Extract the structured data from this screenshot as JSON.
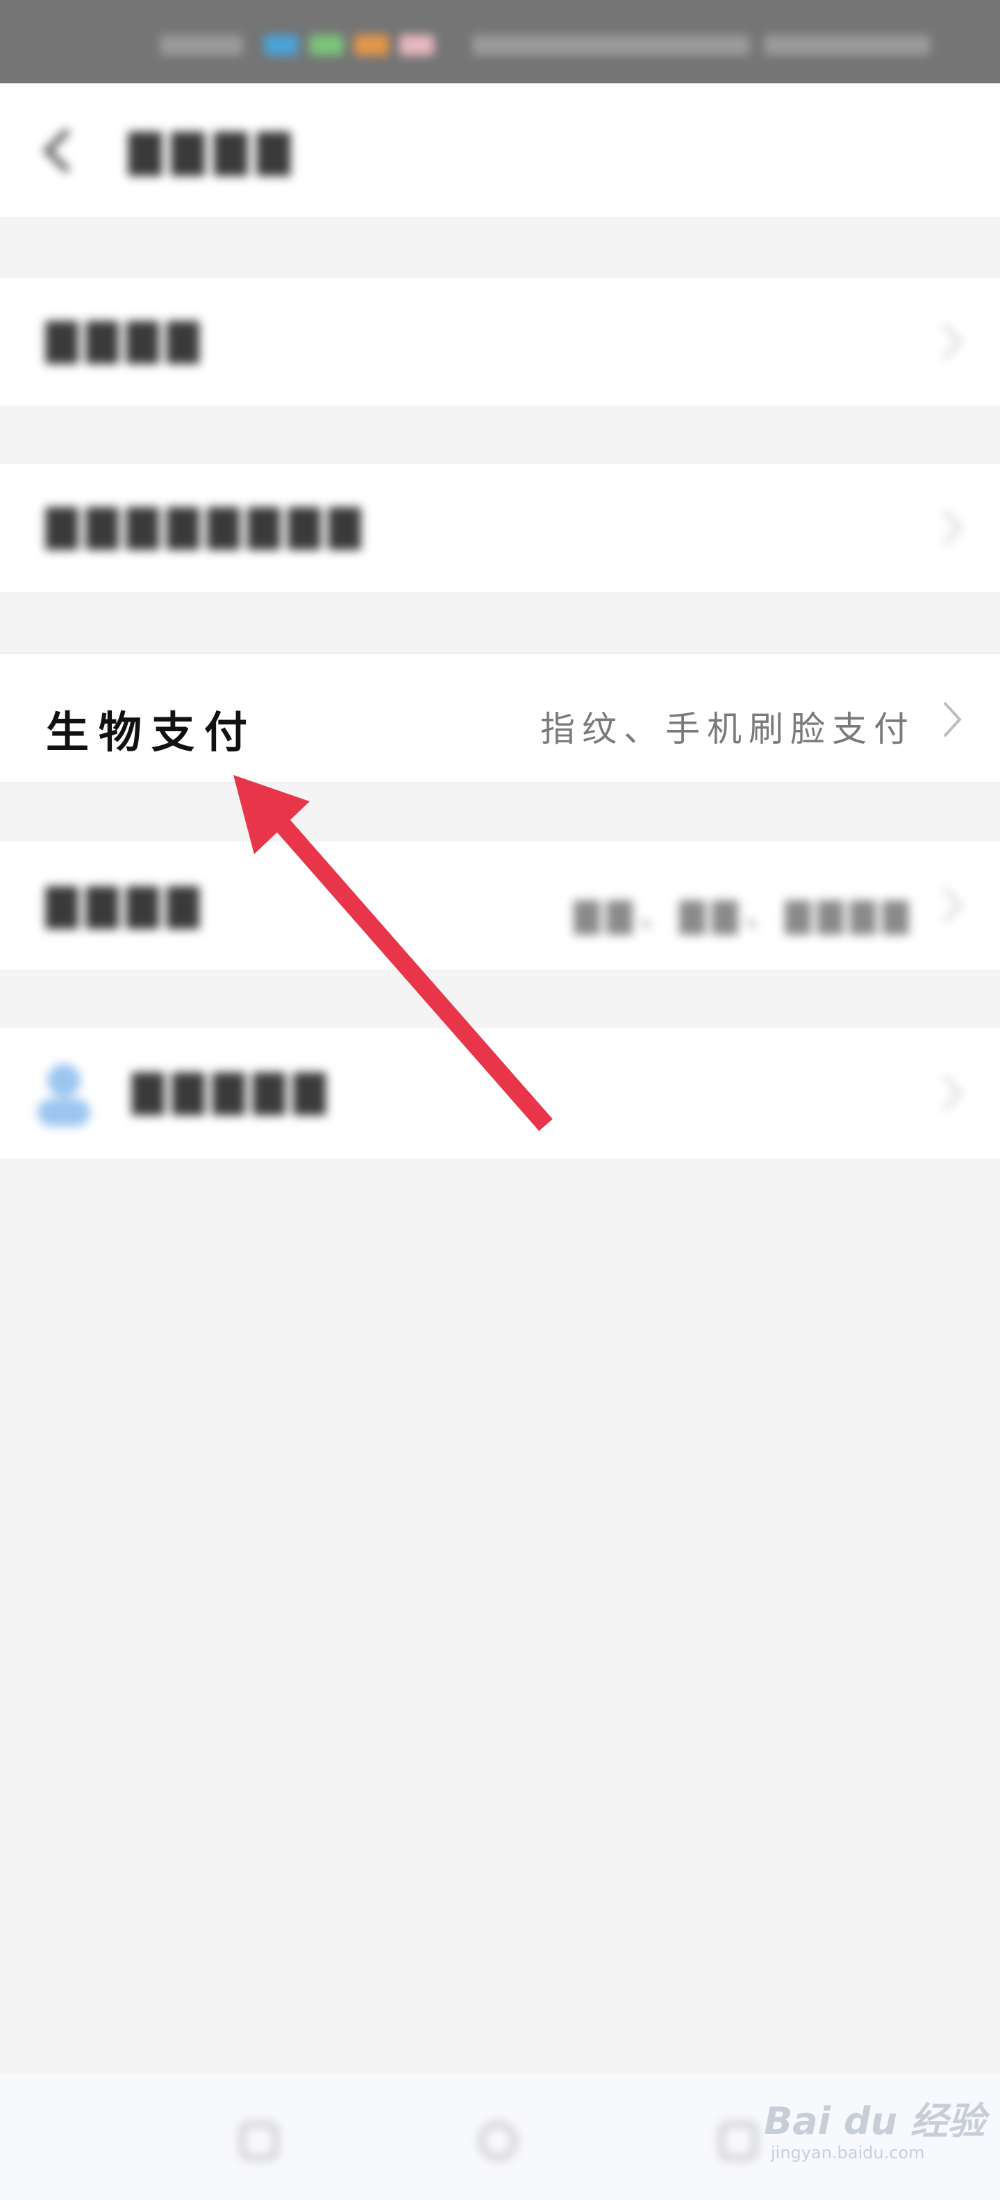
{
  "status_bar": {
    "time": ""
  },
  "header": {
    "title": ""
  },
  "rows": [
    {
      "label": "",
      "value": ""
    },
    {
      "label": "",
      "value": ""
    },
    {
      "label": "生物支付",
      "value": "指纹、手机刷脸支付"
    },
    {
      "label": "",
      "value": ""
    },
    {
      "label": "",
      "value": ""
    }
  ],
  "bottom_nav": {
    "icons": [
      "menu-icon",
      "home-icon",
      "back-icon"
    ]
  },
  "watermark": {
    "brand": "Bai du 经验",
    "url": "jingyan.baidu.com"
  },
  "annotation": {
    "arrow_color": "#e8354a"
  },
  "colors": {
    "background": "#f4f4f4",
    "card": "#ffffff",
    "status_bar": "#757575"
  }
}
